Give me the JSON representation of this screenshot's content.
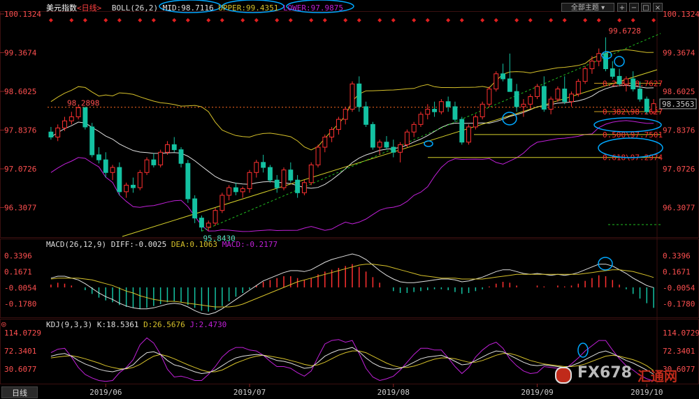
{
  "main_header": {
    "title": "美元指数",
    "period": "<日线>",
    "boll": "BOLL(26,2)",
    "mid": "MID:98.7116",
    "upper": "UPPER:99.4351",
    "lower": "LOWER:97.9875"
  },
  "toolbar": {
    "theme_label": "全部主题",
    "buttons": [
      "+",
      "−",
      "□",
      "×"
    ]
  },
  "macd_header": {
    "name": "MACD(26,12,9)",
    "diff": "DIFF:-0.0025",
    "dea": "DEA:0.1063",
    "macd": "MACD:-0.2177"
  },
  "kdj_header": {
    "name": "KDJ(9,3,3)",
    "k": "K:18.5361",
    "d": "D:26.5676",
    "j": "J:2.4730"
  },
  "tab_label": "日线",
  "watermark": {
    "brand": "FX678",
    "cn": "汇通网"
  },
  "colors": {
    "up": "#ff3030",
    "down": "#14c2a2",
    "mid": "#e0e0e0",
    "band": "#d6c12a",
    "lower_band": "#c020d8",
    "fib": "#ff3030",
    "trend": "#d6d02a",
    "annot": "#00a8ff"
  },
  "chart_data": [
    {
      "type": "candlestick",
      "title": "美元指数",
      "y_ticks": [
        "100.1324",
        "99.3674",
        "98.6025",
        "97.8376",
        "97.0726",
        "96.3077"
      ],
      "ylim": [
        95.75,
        100.1324
      ],
      "x_ticks": [
        "2019/06",
        "2019/07",
        "2019/08",
        "2019/09",
        "2019/10"
      ],
      "price_labels": {
        "high": "99.6728",
        "low": "95.8430",
        "dotted_level": "98.2898",
        "last": "98.3563"
      },
      "fib_labels": [
        "0.236\\98.7627",
        "0.382\\98.2027",
        "0.500\\97.7501",
        "0.618\\97.2974"
      ],
      "candles": [
        [
          97.8,
          97.9,
          97.65,
          97.7
        ],
        [
          97.7,
          97.95,
          97.62,
          97.88
        ],
        [
          97.88,
          98.1,
          97.82,
          98.02
        ],
        [
          98.02,
          98.2,
          97.95,
          98.1
        ],
        [
          98.1,
          98.32,
          98.05,
          98.28
        ],
        [
          98.28,
          98.3,
          97.85,
          97.9
        ],
        [
          97.9,
          97.98,
          97.3,
          97.35
        ],
        [
          97.35,
          97.5,
          97.18,
          97.25
        ],
        [
          97.25,
          97.4,
          96.9,
          97.0
        ],
        [
          97.0,
          97.15,
          96.85,
          97.1
        ],
        [
          97.1,
          97.2,
          96.55,
          96.62
        ],
        [
          96.62,
          96.8,
          96.5,
          96.75
        ],
        [
          96.75,
          96.9,
          96.6,
          96.7
        ],
        [
          96.7,
          97.05,
          96.65,
          97.0
        ],
        [
          97.0,
          97.3,
          96.95,
          97.25
        ],
        [
          97.25,
          97.38,
          97.1,
          97.15
        ],
        [
          97.15,
          97.45,
          97.1,
          97.4
        ],
        [
          97.4,
          97.62,
          97.35,
          97.55
        ],
        [
          97.55,
          97.7,
          97.4,
          97.45
        ],
        [
          97.45,
          97.5,
          97.1,
          97.18
        ],
        [
          97.18,
          97.25,
          96.4,
          96.48
        ],
        [
          96.48,
          96.55,
          96.0,
          96.1
        ],
        [
          96.1,
          96.15,
          95.84,
          95.92
        ],
        [
          95.92,
          96.05,
          95.85,
          96.0
        ],
        [
          96.0,
          96.3,
          95.95,
          96.25
        ],
        [
          96.25,
          96.6,
          96.2,
          96.55
        ],
        [
          96.55,
          96.75,
          96.45,
          96.7
        ],
        [
          96.7,
          96.8,
          96.55,
          96.62
        ],
        [
          96.62,
          96.72,
          96.5,
          96.68
        ],
        [
          96.68,
          97.05,
          96.6,
          97.0
        ],
        [
          97.0,
          97.25,
          96.9,
          97.2
        ],
        [
          97.2,
          97.35,
          97.0,
          97.1
        ],
        [
          97.1,
          97.15,
          96.8,
          96.85
        ],
        [
          96.85,
          96.95,
          96.6,
          96.7
        ],
        [
          96.7,
          97.1,
          96.65,
          97.05
        ],
        [
          97.05,
          97.2,
          96.8,
          96.85
        ],
        [
          96.85,
          96.95,
          96.5,
          96.6
        ],
        [
          96.6,
          96.85,
          96.55,
          96.8
        ],
        [
          96.8,
          97.2,
          96.75,
          97.15
        ],
        [
          97.15,
          97.55,
          97.1,
          97.5
        ],
        [
          97.5,
          97.75,
          97.4,
          97.7
        ],
        [
          97.7,
          97.9,
          97.6,
          97.85
        ],
        [
          97.85,
          98.1,
          97.75,
          98.05
        ],
        [
          98.05,
          98.3,
          97.95,
          98.25
        ],
        [
          98.25,
          98.8,
          98.2,
          98.75
        ],
        [
          98.75,
          98.9,
          98.2,
          98.3
        ],
        [
          98.3,
          98.4,
          97.9,
          97.95
        ],
        [
          97.95,
          98.0,
          97.45,
          97.5
        ],
        [
          97.5,
          97.65,
          97.35,
          97.6
        ],
        [
          97.6,
          97.72,
          97.45,
          97.5
        ],
        [
          97.5,
          97.65,
          97.3,
          97.4
        ],
        [
          97.4,
          97.6,
          97.2,
          97.55
        ],
        [
          97.55,
          97.85,
          97.5,
          97.8
        ],
        [
          97.8,
          98.0,
          97.7,
          97.95
        ],
        [
          97.95,
          98.2,
          97.9,
          98.15
        ],
        [
          98.15,
          98.35,
          98.05,
          98.25
        ],
        [
          98.25,
          98.4,
          98.1,
          98.2
        ],
        [
          98.2,
          98.45,
          98.15,
          98.4
        ],
        [
          98.4,
          98.5,
          98.2,
          98.3
        ],
        [
          98.3,
          98.4,
          98.0,
          98.05
        ],
        [
          98.05,
          98.1,
          97.55,
          97.6
        ],
        [
          97.6,
          97.95,
          97.55,
          97.9
        ],
        [
          97.9,
          98.15,
          97.85,
          98.1
        ],
        [
          98.1,
          98.4,
          98.05,
          98.35
        ],
        [
          98.35,
          98.7,
          98.3,
          98.65
        ],
        [
          98.65,
          99.0,
          98.6,
          98.95
        ],
        [
          98.95,
          99.15,
          98.8,
          98.85
        ],
        [
          98.85,
          99.35,
          98.65,
          98.6
        ],
        [
          98.6,
          98.75,
          98.2,
          98.3
        ],
        [
          98.3,
          98.45,
          98.1,
          98.35
        ],
        [
          98.35,
          98.55,
          98.25,
          98.5
        ],
        [
          98.5,
          98.75,
          98.45,
          98.7
        ],
        [
          98.7,
          98.9,
          98.2,
          98.25
        ],
        [
          98.25,
          98.5,
          98.15,
          98.45
        ],
        [
          98.45,
          98.7,
          98.4,
          98.65
        ],
        [
          98.65,
          98.9,
          98.35,
          98.4
        ],
        [
          98.4,
          98.6,
          98.3,
          98.55
        ],
        [
          98.55,
          98.85,
          98.5,
          98.8
        ],
        [
          98.8,
          99.1,
          98.75,
          99.05
        ],
        [
          99.05,
          99.3,
          98.95,
          99.2
        ],
        [
          99.2,
          99.45,
          99.1,
          99.35
        ],
        [
          99.35,
          99.67,
          99.0,
          99.05
        ],
        [
          99.05,
          99.2,
          98.85,
          98.9
        ],
        [
          98.9,
          99.05,
          98.7,
          98.75
        ],
        [
          98.75,
          98.9,
          98.6,
          98.85
        ],
        [
          98.85,
          99.0,
          98.6,
          98.65
        ],
        [
          98.65,
          98.8,
          98.4,
          98.45
        ],
        [
          98.45,
          98.5,
          98.15,
          98.2
        ],
        [
          98.2,
          98.45,
          98.15,
          98.36
        ]
      ]
    },
    {
      "type": "macd",
      "y_ticks": [
        "0.3396",
        "0.1671",
        "-0.0054",
        "-0.1780"
      ],
      "ylim": [
        -0.3,
        0.42
      ],
      "histogram": [
        0.03,
        0.05,
        0.04,
        0.02,
        0.0,
        -0.03,
        -0.07,
        -0.11,
        -0.14,
        -0.16,
        -0.19,
        -0.21,
        -0.22,
        -0.23,
        -0.22,
        -0.2,
        -0.18,
        -0.16,
        -0.15,
        -0.16,
        -0.19,
        -0.22,
        -0.25,
        -0.26,
        -0.24,
        -0.2,
        -0.15,
        -0.1,
        -0.06,
        -0.02,
        0.02,
        0.06,
        0.08,
        0.1,
        0.12,
        0.12,
        0.1,
        0.08,
        0.1,
        0.14,
        0.17,
        0.19,
        0.21,
        0.23,
        0.25,
        0.22,
        0.17,
        0.11,
        0.05,
        0.0,
        -0.04,
        -0.06,
        -0.06,
        -0.05,
        -0.04,
        -0.03,
        -0.02,
        -0.02,
        -0.03,
        -0.05,
        -0.07,
        -0.06,
        -0.04,
        -0.02,
        0.01,
        0.04,
        0.06,
        0.05,
        0.02,
        0.0,
        0.0,
        0.02,
        0.01,
        0.0,
        0.02,
        0.01,
        0.02,
        0.04,
        0.07,
        0.1,
        0.13,
        0.12,
        0.08,
        0.03,
        -0.02,
        -0.07,
        -0.12,
        -0.17,
        -0.22
      ],
      "diff": [
        0.1,
        0.12,
        0.12,
        0.1,
        0.08,
        0.04,
        -0.01,
        -0.06,
        -0.1,
        -0.13,
        -0.17,
        -0.2,
        -0.22,
        -0.23,
        -0.23,
        -0.22,
        -0.2,
        -0.18,
        -0.17,
        -0.18,
        -0.21,
        -0.25,
        -0.28,
        -0.29,
        -0.27,
        -0.23,
        -0.18,
        -0.13,
        -0.08,
        -0.03,
        0.02,
        0.07,
        0.1,
        0.13,
        0.16,
        0.18,
        0.18,
        0.17,
        0.19,
        0.23,
        0.27,
        0.3,
        0.32,
        0.34,
        0.36,
        0.34,
        0.3,
        0.24,
        0.18,
        0.13,
        0.09,
        0.06,
        0.05,
        0.05,
        0.06,
        0.07,
        0.08,
        0.09,
        0.09,
        0.08,
        0.06,
        0.07,
        0.09,
        0.11,
        0.14,
        0.17,
        0.19,
        0.19,
        0.17,
        0.15,
        0.14,
        0.15,
        0.14,
        0.13,
        0.14,
        0.13,
        0.14,
        0.16,
        0.19,
        0.22,
        0.25,
        0.25,
        0.23,
        0.19,
        0.15,
        0.1,
        0.06,
        0.02,
        -0.0025
      ],
      "dea": [
        0.09,
        0.1,
        0.1,
        0.1,
        0.1,
        0.09,
        0.08,
        0.06,
        0.04,
        0.02,
        -0.01,
        -0.04,
        -0.06,
        -0.09,
        -0.11,
        -0.13,
        -0.14,
        -0.15,
        -0.15,
        -0.16,
        -0.17,
        -0.18,
        -0.19,
        -0.2,
        -0.21,
        -0.21,
        -0.21,
        -0.2,
        -0.18,
        -0.15,
        -0.12,
        -0.09,
        -0.06,
        -0.03,
        0.0,
        0.03,
        0.06,
        0.08,
        0.1,
        0.12,
        0.14,
        0.16,
        0.18,
        0.2,
        0.22,
        0.24,
        0.25,
        0.25,
        0.24,
        0.23,
        0.21,
        0.19,
        0.17,
        0.15,
        0.13,
        0.12,
        0.11,
        0.1,
        0.1,
        0.1,
        0.09,
        0.09,
        0.09,
        0.09,
        0.1,
        0.11,
        0.12,
        0.13,
        0.14,
        0.14,
        0.14,
        0.14,
        0.14,
        0.14,
        0.14,
        0.14,
        0.14,
        0.14,
        0.15,
        0.16,
        0.17,
        0.18,
        0.19,
        0.19,
        0.18,
        0.17,
        0.15,
        0.13,
        0.1063
      ]
    },
    {
      "type": "kdj",
      "y_ticks": [
        "114.0729",
        "72.3401",
        "30.6077"
      ],
      "ylim": [
        0,
        125
      ],
      "k": [
        60,
        64,
        66,
        60,
        50,
        42,
        36,
        30,
        26,
        24,
        28,
        32,
        40,
        56,
        68,
        70,
        64,
        50,
        40,
        36,
        30,
        24,
        20,
        22,
        28,
        38,
        48,
        56,
        60,
        62,
        64,
        62,
        56,
        50,
        48,
        44,
        38,
        32,
        34,
        46,
        60,
        68,
        74,
        76,
        80,
        70,
        56,
        44,
        36,
        32,
        30,
        32,
        38,
        46,
        54,
        58,
        60,
        62,
        56,
        48,
        40,
        42,
        50,
        58,
        66,
        72,
        70,
        62,
        54,
        46,
        40,
        38,
        40,
        38,
        36,
        34,
        38,
        44,
        52,
        60,
        68,
        72,
        66,
        58,
        50,
        44,
        36,
        28,
        18.5
      ],
      "d": [
        56,
        58,
        60,
        61,
        58,
        54,
        49,
        44,
        38,
        34,
        31,
        31,
        34,
        41,
        51,
        60,
        64,
        60,
        54,
        47,
        40,
        34,
        28,
        24,
        24,
        28,
        36,
        44,
        50,
        56,
        60,
        62,
        60,
        57,
        54,
        50,
        46,
        41,
        38,
        40,
        46,
        54,
        62,
        68,
        72,
        72,
        68,
        60,
        52,
        44,
        38,
        34,
        34,
        37,
        42,
        48,
        53,
        56,
        56,
        54,
        50,
        46,
        46,
        50,
        56,
        62,
        66,
        66,
        62,
        56,
        50,
        46,
        42,
        40,
        38,
        36,
        36,
        38,
        42,
        48,
        54,
        60,
        62,
        60,
        56,
        52,
        46,
        38,
        26.6
      ],
      "j": [
        68,
        76,
        78,
        58,
        34,
        18,
        10,
        4,
        2,
        4,
        22,
        34,
        52,
        86,
        102,
        90,
        64,
        30,
        12,
        14,
        10,
        4,
        4,
        18,
        36,
        58,
        72,
        80,
        80,
        74,
        72,
        62,
        48,
        36,
        36,
        32,
        22,
        14,
        26,
        58,
        88,
        96,
        98,
        92,
        96,
        66,
        32,
        12,
        4,
        8,
        14,
        28,
        46,
        64,
        78,
        78,
        74,
        74,
        56,
        36,
        20,
        34,
        58,
        74,
        86,
        92,
        78,
        54,
        38,
        26,
        20,
        22,
        36,
        34,
        32,
        30,
        42,
        56,
        72,
        84,
        96,
        96,
        74,
        54,
        38,
        28,
        16,
        8,
        2.5
      ]
    }
  ]
}
